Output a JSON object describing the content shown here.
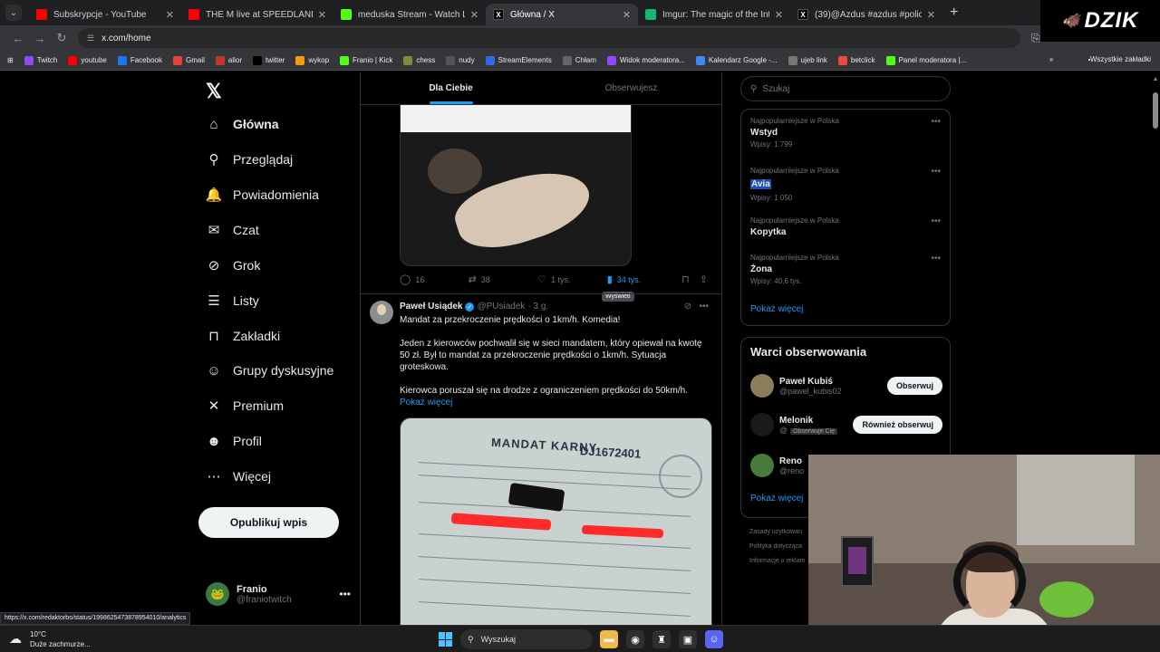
{
  "browser": {
    "tabs": [
      {
        "title": "Subskrypcje - YouTube",
        "color": "#ff0000"
      },
      {
        "title": "THE M live at SPEEDLAND FEST",
        "color": "#ff0000"
      },
      {
        "title": "meduska Stream - Watch Live o",
        "color": "#53fc18"
      },
      {
        "title": "Główna / X",
        "color": "#000000"
      },
      {
        "title": "Imgur: The magic of the Interne",
        "color": "#1bb76e"
      },
      {
        "title": "(39)@Azdus #azdus #policja #",
        "color": "#000000"
      }
    ],
    "active_tab_index": 3,
    "url": "x.com/home",
    "bookmarks": [
      "Twitch",
      "youtube",
      "Facebook",
      "Gmail",
      "alior",
      "twitter",
      "wykop",
      "Franio | Kick",
      "chess",
      "nudy",
      "StreamElements",
      "Chłam",
      "Widok moderatora...",
      "Kalendarz Google -...",
      "ujeb link",
      "betclick",
      "Panel moderatora |..."
    ],
    "all_bookmarks": "Wszystkie zakładki",
    "status_url": "https://x.com/redaktorbs/status/1998625473878954010/analytics"
  },
  "overlay": {
    "brand": "DZIK"
  },
  "nav": {
    "items": [
      {
        "label": "Główna",
        "icon": "home-icon",
        "glyph": "⌂"
      },
      {
        "label": "Przeglądaj",
        "icon": "search-icon",
        "glyph": "⚲"
      },
      {
        "label": "Powiadomienia",
        "icon": "bell-icon",
        "glyph": "🔔"
      },
      {
        "label": "Czat",
        "icon": "mail-icon",
        "glyph": "✉"
      },
      {
        "label": "Grok",
        "icon": "grok-icon",
        "glyph": "⊘"
      },
      {
        "label": "Listy",
        "icon": "list-icon",
        "glyph": "☰"
      },
      {
        "label": "Zakładki",
        "icon": "bookmark-icon",
        "glyph": "⊓"
      },
      {
        "label": "Grupy dyskusyjne",
        "icon": "people-icon",
        "glyph": "☺"
      },
      {
        "label": "Premium",
        "icon": "x-icon",
        "glyph": "✕"
      },
      {
        "label": "Profil",
        "icon": "user-icon",
        "glyph": "☻"
      },
      {
        "label": "Więcej",
        "icon": "more-icon",
        "glyph": "⋯"
      }
    ],
    "post_button": "Opublikuj wpis",
    "profile": {
      "name": "Franio",
      "handle": "@franiotwitch"
    }
  },
  "feed": {
    "tabs": [
      "Dla Ciebie",
      "Obserwujesz"
    ],
    "tweet1_actions": {
      "replies": "16",
      "reposts": "38",
      "likes": "1 tys.",
      "views": "34 tys.",
      "tooltip": "Wyświetl"
    },
    "tweet2": {
      "name": "Paweł Usiądek",
      "handle": "@PUsiadek",
      "time": "· 3 g.",
      "text1": "Mandat za przekroczenie prędkości o 1km/h. Komedia!",
      "text2": "Jeden z kierowców pochwalił się w sieci mandatem, który opiewał na kwotę 50 zł. Był to mandat za przekroczenie prędkości o 1km/h. Sytuacja groteskowa.",
      "text3": "Kierowca poruszał się na drodze z ograniczeniem prędkości do 50km/h.",
      "show_more": "Pokaż więcej",
      "image": {
        "title": "MANDAT KARNY",
        "number": "DJ1672401"
      }
    }
  },
  "sidebar": {
    "search_placeholder": "Szukaj",
    "trends": [
      {
        "context": "Najpopularniejsze w Polska",
        "name": "Wstyd",
        "count": "Wpisy: 1 799"
      },
      {
        "context": "Najpopularniejsze w Polska",
        "name": "Avia",
        "count": "Wpisy: 1 050"
      },
      {
        "context": "Najpopularniejsze w Polska",
        "name": "Kopytka",
        "count": ""
      },
      {
        "context": "Najpopularniejsze w Polska",
        "name": "Żona",
        "count": "Wpisy: 40,6 tys."
      }
    ],
    "show_more": "Pokaż więcej",
    "who_to_follow": {
      "title": "Warci obserwowania",
      "users": [
        {
          "name": "Paweł Kubiś",
          "handle": "@pawel_kubis02",
          "button": "Obserwuj",
          "badge": ""
        },
        {
          "name": "Melonik",
          "handle": "@",
          "button": "Również obserwuj",
          "badge": "Obserwuje Cię"
        },
        {
          "name": "Reno",
          "handle": "@reno",
          "button": "",
          "badge": ""
        }
      ],
      "show_more": "Pokaż więcej"
    },
    "footer": [
      "Zasady użytkowan",
      "Polityka dotycząca",
      "Informacje o reklam"
    ]
  },
  "taskbar": {
    "temp": "10°C",
    "weather": "Duże zachmurze...",
    "search": "Wyszukaj"
  }
}
